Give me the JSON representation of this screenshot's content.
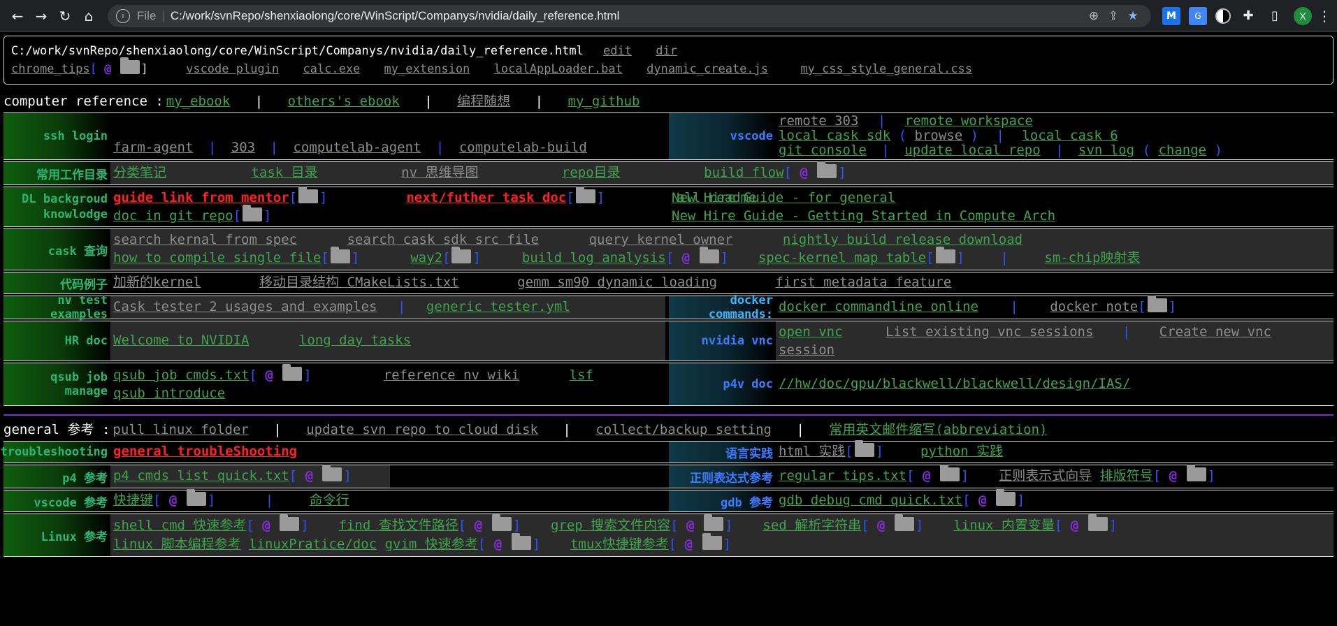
{
  "browser": {
    "scheme": "File",
    "url": "C:/work/svnRepo/shenxiaolong/core/WinScript/Companys/nvidia/daily_reference.html",
    "avatar_letter": "X",
    "ext_m": "M",
    "ext_translate": "G"
  },
  "top": {
    "path": "C:/work/svnRepo/shenxiaolong/core/WinScript/Companys/nvidia/daily_reference.html",
    "edit": "edit",
    "dir": "dir",
    "chrome_tips": "chrome_tips",
    "links": [
      "vscode plugin",
      "calc.exe",
      "my_extension",
      "localAppLoader.bat",
      "dynamic_create.js",
      "my_css_style_general.css"
    ]
  },
  "computer_ref": {
    "title": "computer reference :",
    "links": [
      "my_ebook",
      "others's ebook",
      "编程随想",
      "my_github"
    ]
  },
  "ssh": {
    "label": "ssh login",
    "links": [
      "farm-agent",
      "303",
      "computelab-agent",
      "computelab-build"
    ]
  },
  "vscode": {
    "label": "vscode",
    "remote303": "remote 303",
    "remote_ws": "remote workspace",
    "local_cask_sdk": "local cask sdk",
    "browse": "browse",
    "local_cask6": "local cask 6",
    "git_console": "git console",
    "update_local": "update local repo",
    "svn_log": "svn log",
    "change": "change"
  },
  "work_dir": {
    "label": "常用工作目录",
    "links": [
      "分类笔记",
      "task 目录",
      "nv 思维导图",
      "repo目录",
      "build flow"
    ]
  },
  "dl": {
    "label1": "DL backgroud",
    "label2": "knowlodge",
    "guide": "guide link from mentor",
    "next": "next/futher task doc",
    "all_readme": "all readme",
    "doc_git": "doc in git repo",
    "hire1": "New Hire Guide - for general",
    "hire2": "New Hire Guide - Getting Started in Compute Arch"
  },
  "cask": {
    "label": "cask 查询",
    "row1": [
      "search kernal from spec",
      "search cask sdk src file",
      "query kernel owner",
      "nightly build release download"
    ],
    "compile": "how to compile single file",
    "way2": "way2",
    "build_log": "build log analysis",
    "spec_map": "spec-kernel map table",
    "sm_chip": "sm-chip映射表"
  },
  "code": {
    "label": "代码例子",
    "links": [
      "加新的kernel",
      "移动目录结构 CMakeLists.txt",
      "gemm sm90 dynamic loading",
      "first metadata feature"
    ]
  },
  "nvtest": {
    "label": "nv test examples",
    "tester": "Cask tester 2 usages and examples",
    "generic": "generic tester.yml"
  },
  "docker": {
    "label": "docker commands:",
    "online": "docker commandline online",
    "note": "docker note"
  },
  "hr": {
    "label": "HR doc",
    "welcome": "Welcome to NVIDIA",
    "long_day": "long day tasks"
  },
  "vnc": {
    "label": "nvidia vnc",
    "open": "open vnc",
    "list": "List existing vnc sessions",
    "create": "Create new vnc",
    "session": "session"
  },
  "qsub": {
    "label": "qsub job manage",
    "cmds": "qsub job cmds.txt",
    "ref": "reference nv wiki",
    "lsf": "lsf",
    "intro": "qsub introduce"
  },
  "p4v": {
    "label": "p4v doc",
    "path": "//hw/doc/gpu/blackwell/blackwell/design/IAS/"
  },
  "general": {
    "title": "general 参考 :",
    "links": [
      "pull linux folder",
      "update svn repo to cloud disk",
      "collect/backup setting",
      "常用英文邮件缩写(abbreviation)"
    ]
  },
  "trouble": {
    "label": "troubleshooting",
    "link": "general troubleShooting"
  },
  "lang": {
    "label": "语言实践",
    "html": "html 实践",
    "python": "python 实践"
  },
  "p4": {
    "label": "p4 参考",
    "link": "p4 cmds list quick.txt"
  },
  "regex": {
    "label": "正则表达式参考",
    "tips": "regular tips.txt",
    "guide": "正则表示式向导",
    "typeset": "排版符号"
  },
  "vscode_ref": {
    "label": "vscode 参考",
    "keys": "快捷键",
    "cmd": "命令行"
  },
  "gdb": {
    "label": "gdb 参考",
    "link": "gdb debug cmd quick.txt"
  },
  "linux": {
    "label": "Linux 参考",
    "row1": [
      "shell cmd 快速参考",
      "find 查找文件路径",
      "grep 搜索文件内容",
      "sed 解析字符串",
      "linux 内置变量"
    ],
    "script": "linux 脚本编程参考",
    "pratice": "linuxPratice/doc",
    "gvim": "gvim 快速参考",
    "tmux": "tmux快捷键参考"
  },
  "colors": {
    "green_label": "#2bb673",
    "blue_label": "#3d7bff",
    "link_grey": "#8c8c8c",
    "link_green": "#3fa34d",
    "red": "#ff2020",
    "bracket": "#2855ff",
    "at": "#8a2be2",
    "divider": "#7b2fd1"
  },
  "symbols": {
    "at": "@",
    "lb": "[",
    "rb": "]",
    "lp": "(",
    "rp": ")",
    "pipe": "|"
  }
}
